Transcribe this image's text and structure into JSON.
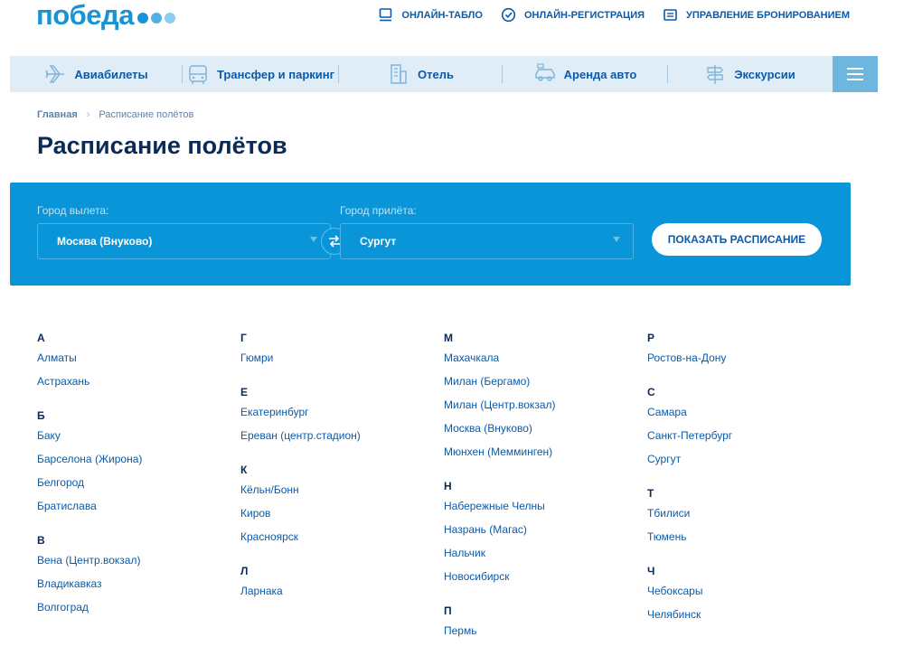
{
  "logo": {
    "text": "победа"
  },
  "top_links": [
    {
      "label": "ОНЛАЙН-ТАБЛО",
      "icon": "monitor-icon"
    },
    {
      "label": "ОНЛАЙН-РЕГИСТРАЦИЯ",
      "icon": "check-circle-icon"
    },
    {
      "label": "УПРАВЛЕНИЕ БРОНИРОВАНИЕМ",
      "icon": "ticket-list-icon"
    }
  ],
  "nav": [
    {
      "label": "Авиабилеты",
      "icon": "plane-icon"
    },
    {
      "label": "Трансфер и паркинг",
      "icon": "bus-icon"
    },
    {
      "label": "Отель",
      "icon": "hotel-icon"
    },
    {
      "label": "Аренда авто",
      "icon": "car-icon"
    },
    {
      "label": "Экскурсии",
      "icon": "signpost-icon"
    }
  ],
  "breadcrumb": {
    "home": "Главная",
    "current": "Расписание полётов"
  },
  "page_title": "Расписание полётов",
  "search": {
    "from_label": "Город вылета:",
    "from_value": "Москва (Внуково)",
    "to_label": "Город прилёта:",
    "to_value": "Сургут",
    "submit_label": "ПОКАЗАТЬ РАСПИСАНИЕ"
  },
  "cities": [
    [
      {
        "letter": "А",
        "items": [
          "Алматы",
          "Астрахань"
        ]
      },
      {
        "letter": "Б",
        "items": [
          "Баку",
          "Барселона (Жирона)",
          "Белгород",
          "Братислава"
        ]
      },
      {
        "letter": "В",
        "items": [
          "Вена (Центр.вокзал)",
          "Владикавказ",
          "Волгоград"
        ]
      }
    ],
    [
      {
        "letter": "Г",
        "items": [
          "Гюмри"
        ]
      },
      {
        "letter": "Е",
        "items": [
          "Екатеринбург",
          "Ереван (центр.стадион)"
        ]
      },
      {
        "letter": "К",
        "items": [
          "Кёльн/Бонн",
          "Киров",
          "Красноярск"
        ]
      },
      {
        "letter": "Л",
        "items": [
          "Ларнака"
        ]
      }
    ],
    [
      {
        "letter": "М",
        "items": [
          "Махачкала",
          "Милан (Бергамо)",
          "Милан (Центр.вокзал)",
          "Москва (Внуково)",
          "Мюнхен (Мемминген)"
        ]
      },
      {
        "letter": "Н",
        "items": [
          "Набережные Челны",
          "Назрань (Магас)",
          "Нальчик",
          "Новосибирск"
        ]
      },
      {
        "letter": "П",
        "items": [
          "Пермь"
        ]
      }
    ],
    [
      {
        "letter": "Р",
        "items": [
          "Ростов-на-Дону"
        ]
      },
      {
        "letter": "С",
        "items": [
          "Самара",
          "Санкт-Петербург",
          "Сургут"
        ]
      },
      {
        "letter": "Т",
        "items": [
          "Тбилиси",
          "Тюмень"
        ]
      },
      {
        "letter": "Ч",
        "items": [
          "Чебоксары",
          "Челябинск"
        ]
      }
    ]
  ],
  "colors": {
    "brand": "#1a93d4",
    "panel": "#0b95d9",
    "nav_bg": "#e1edf6",
    "link": "#0b5aa8",
    "title": "#0b2a57"
  }
}
